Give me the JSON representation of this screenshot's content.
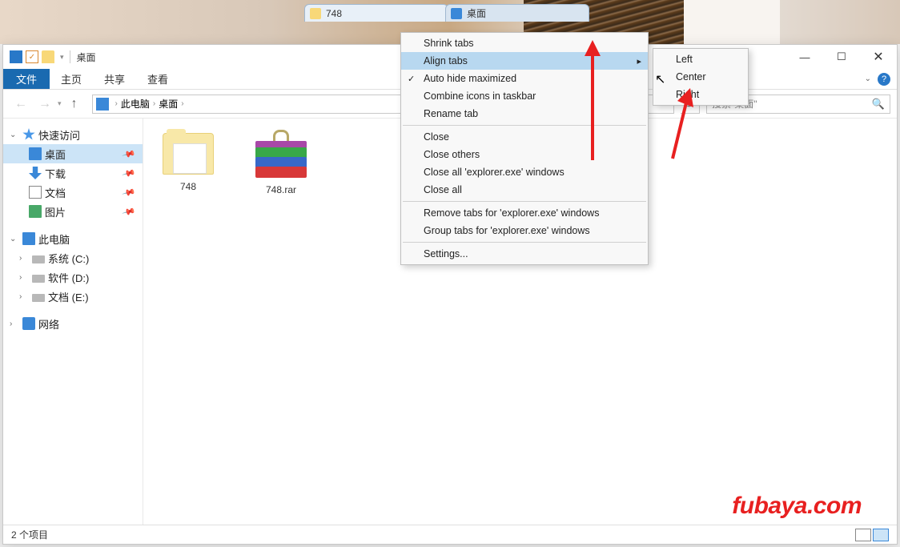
{
  "tabs": [
    {
      "label": "748"
    },
    {
      "label": "桌面"
    }
  ],
  "titlebar": {
    "title": "桌面"
  },
  "ribbon": {
    "file": "文件",
    "tabs": [
      "主页",
      "共享",
      "查看"
    ]
  },
  "address": {
    "parts": [
      "此电脑",
      "桌面"
    ]
  },
  "search": {
    "placeholder": "搜索\"桌面\""
  },
  "sidebar": {
    "quickAccess": "快速访问",
    "desktop": "桌面",
    "downloads": "下载",
    "documents": "文档",
    "pictures": "图片",
    "thisPC": "此电脑",
    "driveC": "系统 (C:)",
    "driveD": "软件 (D:)",
    "driveE": "文档 (E:)",
    "network": "网络"
  },
  "files": [
    {
      "name": "748"
    },
    {
      "name": "748.rar"
    }
  ],
  "statusbar": {
    "count": "2 个项目"
  },
  "contextMenu": {
    "shrink": "Shrink tabs",
    "align": "Align tabs",
    "autoHide": "Auto hide maximized",
    "combine": "Combine icons in taskbar",
    "rename": "Rename tab",
    "close": "Close",
    "closeOthers": "Close others",
    "closeAllExe": "Close all 'explorer.exe' windows",
    "closeAll": "Close all",
    "removeTabs": "Remove tabs for 'explorer.exe' windows",
    "groupTabs": "Group tabs for 'explorer.exe' windows",
    "settings": "Settings..."
  },
  "submenu": {
    "left": "Left",
    "center": "Center",
    "right": "Right"
  },
  "watermark": "fubaya.com"
}
